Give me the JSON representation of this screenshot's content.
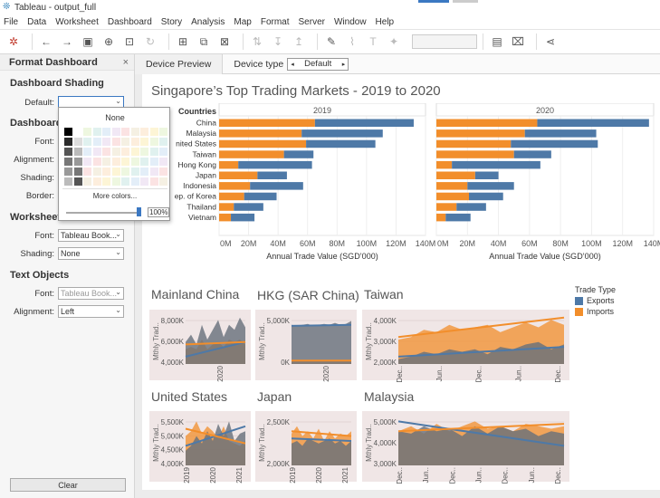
{
  "window": {
    "title": "Tableau - output_full"
  },
  "menu": [
    "File",
    "Data",
    "Worksheet",
    "Dashboard",
    "Story",
    "Analysis",
    "Map",
    "Format",
    "Server",
    "Window",
    "Help"
  ],
  "format_pane": {
    "title": "Format Dashboard",
    "close": "×",
    "shading_section": "Dashboard Shading",
    "default_label": "Default:",
    "title_section": "Dashboard T",
    "font_label": "Font:",
    "alignment_label": "Alignment:",
    "shading_label": "Shading:",
    "border_label": "Border:",
    "worksheet_section": "Worksheet T",
    "ws_font_label": "Font:",
    "ws_font_value": "Tableau Book...",
    "ws_shading_label": "Shading:",
    "ws_shading_value": "None",
    "text_section": "Text Objects",
    "to_font_label": "Font:",
    "to_font_value": "Tableau Book...",
    "to_alignment_label": "Alignment:",
    "to_alignment_value": "Left",
    "clear_label": "Clear"
  },
  "color_popup": {
    "none_label": "None",
    "more_label": "More colors...",
    "opacity": "100%",
    "greys": [
      "#000000",
      "#2b2b2b",
      "#555555",
      "#777777",
      "#999999",
      "#bbbbbb",
      "#dddddd",
      "#ffffff"
    ],
    "pastels": [
      "#fdeedd",
      "#fdf5d6",
      "#eef7e0",
      "#e0f1ef",
      "#e3eef8",
      "#f1e8f5",
      "#fbe3e3",
      "#f5f0e3"
    ]
  },
  "preview_bar": {
    "device_preview": "Device Preview",
    "device_type_label": "Device type",
    "device_type_value": "Default"
  },
  "dashboard": {
    "title": "Singapore’s Top Trading Markets - 2019 to 2020",
    "countries_header": "Countries",
    "legend_title": "Trade Type",
    "legend_exports": "Exports",
    "legend_imports": "Imports",
    "colors": {
      "exports": "#4e79a7",
      "imports": "#f28e2b",
      "bg": "#f0e6e6"
    },
    "x_axis_label": "Annual Trade Value (SGD’000)",
    "mini_charts": [
      {
        "name": "Mainland China",
        "yticks": [
          "8,000K",
          "6,000K",
          "4,000K"
        ],
        "xticks": [
          "2020"
        ]
      },
      {
        "name": "HKG (SAR China)",
        "yticks": [
          "5,000K",
          "0K"
        ],
        "xticks": [
          "2020"
        ]
      },
      {
        "name": "Taiwan",
        "yticks": [
          "4,000K",
          "3,000K",
          "2,000K"
        ],
        "xticks": [
          "Dec..",
          "Jun..",
          "Dec..",
          "Jun..",
          "Dec.."
        ]
      },
      {
        "name": "United States",
        "yticks": [
          "5,500K",
          "5,000K",
          "4,500K",
          "4,000K"
        ],
        "xticks": [
          "2019",
          "2020",
          "2021"
        ]
      },
      {
        "name": "Japan",
        "yticks": [
          "2,500K",
          "2,000K"
        ],
        "xticks": [
          "2019",
          "2020",
          "2021"
        ]
      },
      {
        "name": "Malaysia",
        "yticks": [
          "5,000K",
          "4,000K",
          "3,000K"
        ],
        "xticks": [
          "Dec..",
          "Jun..",
          "Dec..",
          "Jun..",
          "Dec..",
          "Jun..",
          "Dec.."
        ]
      }
    ],
    "mini_ylabel": "Mthly Trad.."
  },
  "chart_data": {
    "type": "bar",
    "title": "Singapore’s Top Trading Markets - 2019 to 2020",
    "xlabel": "Annual Trade Value (SGD’000)",
    "xlim": [
      0,
      140
    ],
    "xticks": [
      "0M",
      "20M",
      "40M",
      "60M",
      "80M",
      "100M",
      "120M",
      "140M"
    ],
    "categories": [
      "China",
      "Malaysia",
      "United States",
      "Taiwan",
      "Hong Kong",
      "Japan",
      "Indonesia",
      "Rep. of Korea",
      "Thailand",
      "Vietnam"
    ],
    "category_labels": [
      "China",
      "Malaysia",
      "nited States",
      "Taiwan",
      "Hong Kong",
      "Japan",
      "Indonesia",
      "ep. of Korea",
      "Thailand",
      "Vietnam"
    ],
    "panels": [
      {
        "year": "2019",
        "series": [
          {
            "name": "Imports",
            "values": [
              65,
              56,
              59,
              44,
              13,
              26,
              21,
              17,
              10,
              8
            ]
          },
          {
            "name": "Exports",
            "values": [
              67,
              55,
              47,
              20,
              50,
              20,
              36,
              22,
              20,
              16
            ]
          }
        ]
      },
      {
        "year": "2020",
        "series": [
          {
            "name": "Imports",
            "values": [
              65,
              57,
              48,
              50,
              10,
              25,
              20,
              21,
              13,
              6
            ]
          },
          {
            "name": "Exports",
            "values": [
              72,
              46,
              56,
              24,
              57,
              15,
              30,
              22,
              19,
              16
            ]
          }
        ]
      }
    ]
  }
}
